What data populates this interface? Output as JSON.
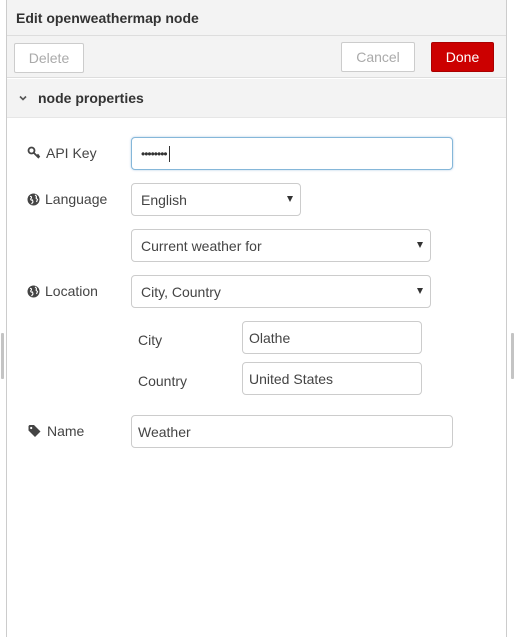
{
  "dialog": {
    "title": "Edit openweathermap node"
  },
  "toolbar": {
    "delete_label": "Delete",
    "cancel_label": "Cancel",
    "done_label": "Done"
  },
  "section": {
    "title": "node properties"
  },
  "form": {
    "api_key": {
      "label": "API Key",
      "value": "••••••••"
    },
    "language": {
      "label": "Language",
      "selected": "English"
    },
    "mode": {
      "selected": "Current weather for"
    },
    "location": {
      "label": "Location",
      "selected": "City, Country"
    },
    "city": {
      "label": "City",
      "value": "Olathe"
    },
    "country": {
      "label": "Country",
      "value": "United States"
    },
    "name": {
      "label": "Name",
      "value": "Weather"
    }
  },
  "colors": {
    "done_button": "#cc0000",
    "focus_border": "#85b7d9",
    "header_bg": "#f3f3f3"
  },
  "icons": [
    "key-icon",
    "globe-icon",
    "tag-icon",
    "chevron-down-icon"
  ]
}
